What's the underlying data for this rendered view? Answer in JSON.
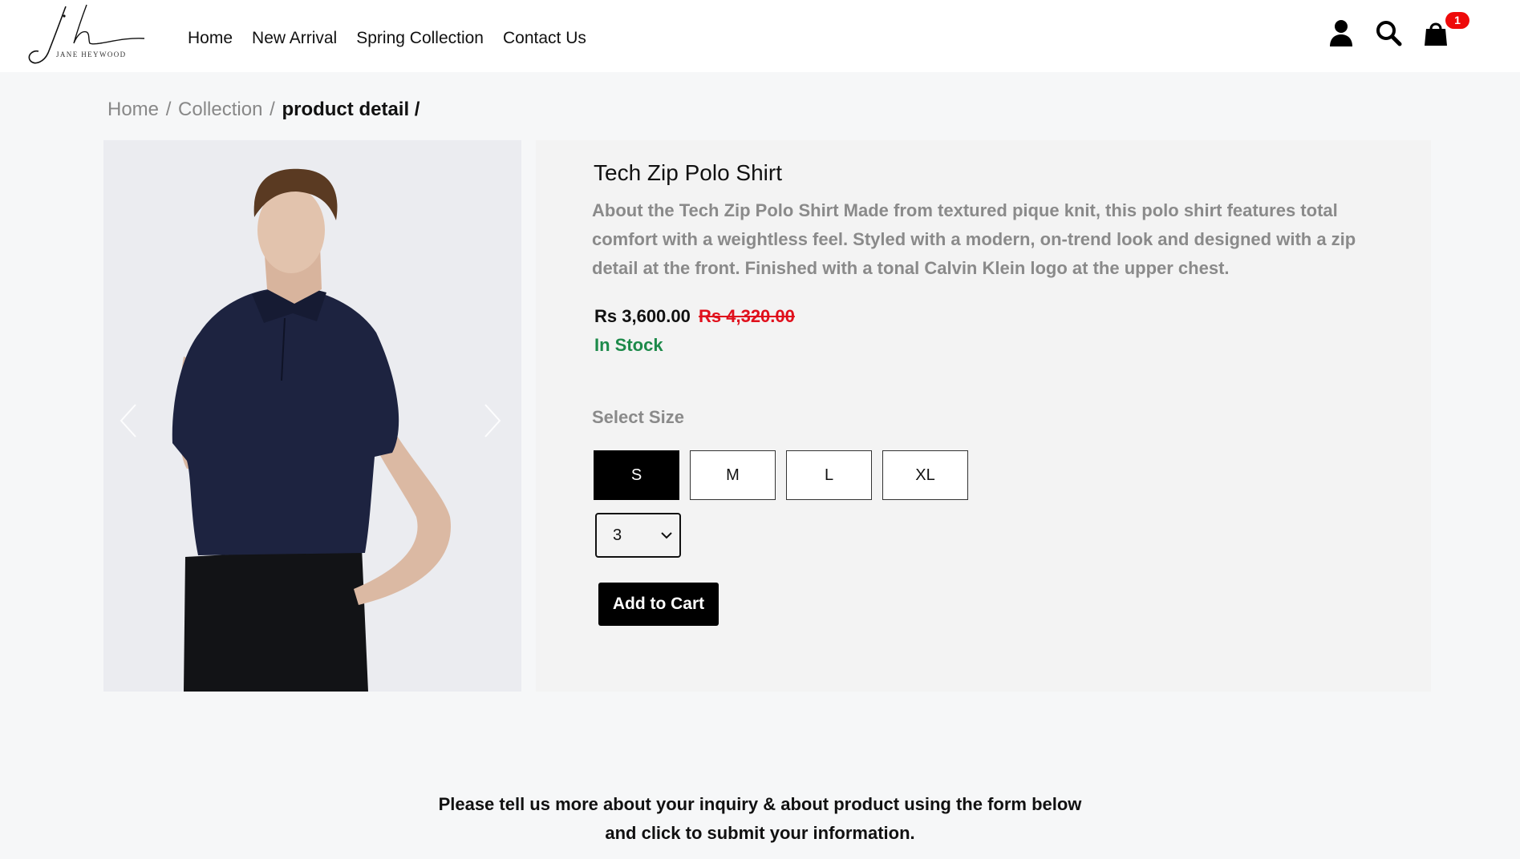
{
  "brand": {
    "logo_text": "JANE HEYWOOD",
    "logo_icon": "jh-script-logo"
  },
  "nav": {
    "links": [
      "Home",
      "New Arrival",
      "Spring Collection",
      "Contact Us"
    ],
    "icons": [
      "user-icon",
      "search-icon",
      "shopping-bag-icon"
    ],
    "cart_count": "1"
  },
  "breadcrumb": {
    "items": [
      "Home",
      "Collection"
    ],
    "separator": "/",
    "current": "product detail /"
  },
  "gallery": {
    "image_subject": "model wearing navy zip polo shirt and black trousers",
    "prev_icon": "chevron-left-icon",
    "next_icon": "chevron-right-icon"
  },
  "product": {
    "title": "Tech Zip Polo Shirt",
    "description": "About the Tech Zip Polo Shirt Made from textured pique knit, this polo shirt features total comfort with a weightless feel. Styled with a modern, on-trend look and designed with a zip detail at the front. Finished with a tonal Calvin Klein logo at the upper chest.",
    "price": "Rs 3,600.00",
    "old_price": "Rs 4,320.00",
    "stock": "In Stock",
    "size_label": "Select Size",
    "sizes": [
      "S",
      "M",
      "L",
      "XL"
    ],
    "selected_size": "S",
    "quantity": "3",
    "add_to_cart": "Add to Cart"
  },
  "inquiry": {
    "line1": "Please tell us more about your inquiry & about product using the form below",
    "line2": "and click to submit your information."
  },
  "colors": {
    "price_old": "#e0101c",
    "stock": "#1d8a4a",
    "badge": "#ee0a0a",
    "panel_bg": "#f3f3f3",
    "page_bg": "#f6f7f8"
  }
}
